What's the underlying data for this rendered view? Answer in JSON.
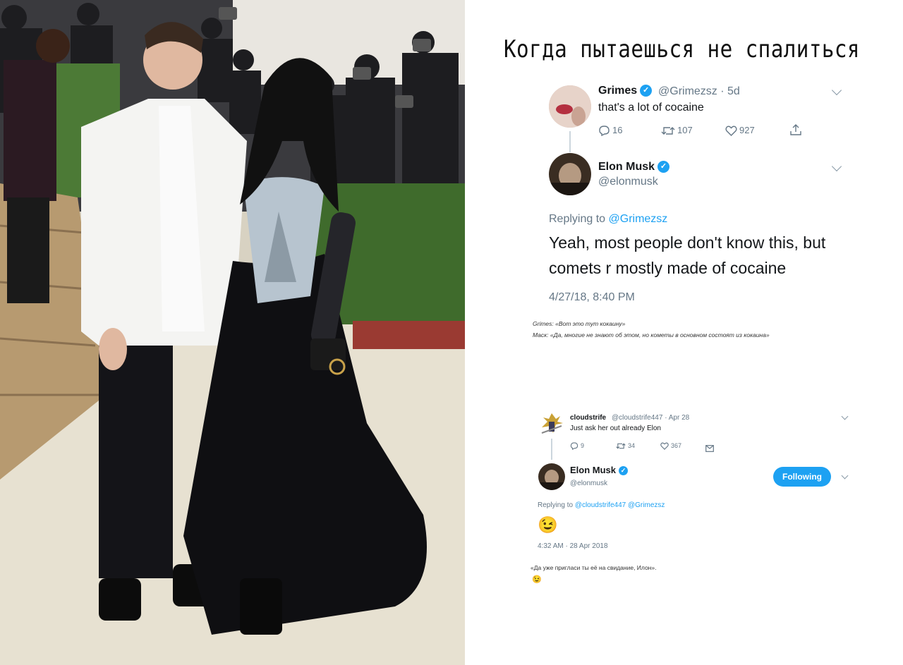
{
  "meme_title": "Когда пытаешься не спалиться",
  "tweet1": {
    "name": "Grimes",
    "handle": "@Grimezsz",
    "time": "· 5d",
    "text": "that's a lot of cocaine",
    "replies": "16",
    "retweets": "107",
    "likes": "927"
  },
  "tweet2": {
    "name": "Elon Musk",
    "handle": "@elonmusk",
    "replying_prefix": "Replying to",
    "replying_to": "@Grimezsz",
    "text_line1": "Yeah, most people don't know this, but",
    "text_line2": "comets r mostly made of cocaine",
    "timestamp": "4/27/18, 8:40 PM"
  },
  "caption1": {
    "line1": "Grimes: «Вот это тут кокаину»",
    "line2": "Маск: «Да, многие не знают об этом, но кометы в основном состоят из кокаина»"
  },
  "tweet3": {
    "name": "cloudstrife",
    "handle": "@cloudstrife447",
    "time": "· Apr 28",
    "text": "Just ask her out already Elon",
    "replies": "9",
    "retweets": "34",
    "likes": "367"
  },
  "tweet4": {
    "name": "Elon Musk",
    "handle": "@elonmusk",
    "follow_label": "Following",
    "replying_prefix": "Replying to",
    "replying_to": "@cloudstrife447 @Grimezsz",
    "emoji": "😉",
    "timestamp": "4:32 AM · 28 Apr 2018"
  },
  "caption2": {
    "line1": "«Да уже пригласи ты её на свидание, Илон».",
    "emoji": "😉"
  },
  "colors": {
    "accent": "#1da1f2",
    "text": "#14171a",
    "muted": "#657786"
  }
}
